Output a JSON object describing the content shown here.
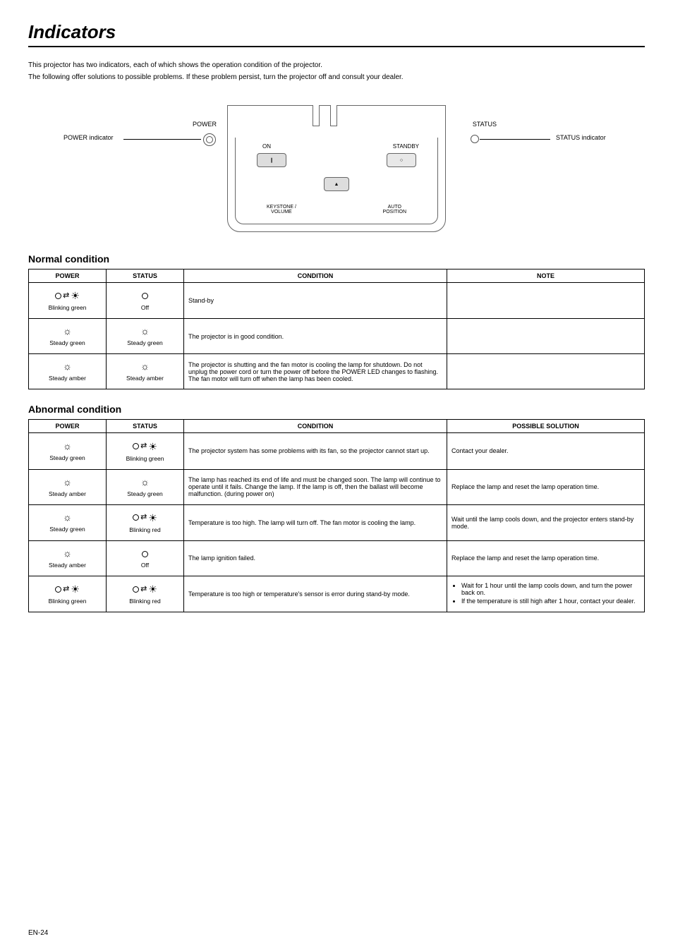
{
  "title": "Indicators",
  "intro": {
    "line1": "This projector has two indicators, each of which shows the operation condition of the projector.",
    "line2": "The following offer solutions to possible problems. If these problem persist, turn the projector off and consult your dealer."
  },
  "diagram": {
    "power_indicator_label": "POWER indicator",
    "status_indicator_label": "STATUS indicator",
    "power_text": "POWER",
    "status_text": "STATUS",
    "btn_on": "ON",
    "btn_standby": "STANDBY",
    "btn_on_glyph": "❙",
    "btn_standby_glyph": "○",
    "btn_tri_glyph": "▲",
    "keystone_label": "KEYSTONE /\nVOLUME",
    "auto_label": "AUTO\nPOSITION"
  },
  "normal": {
    "heading": "Normal condition",
    "headers": {
      "power": "POWER",
      "status": "STATUS",
      "condition": "CONDITION",
      "note": "NOTE"
    },
    "rows": [
      {
        "power": "Blinking green",
        "power_icon": "blink",
        "status": "Off",
        "status_icon": "off",
        "condition": "Stand-by",
        "note": ""
      },
      {
        "power": "Steady green",
        "power_icon": "steady",
        "status": "Steady green",
        "status_icon": "steady",
        "condition": "The projector is in good condition.",
        "note": ""
      },
      {
        "power": "Steady amber",
        "power_icon": "steady",
        "status": "Steady amber",
        "status_icon": "steady",
        "condition": "The projector is shutting and the fan motor is cooling the lamp for shutdown. Do not unplug the power cord or turn the power off before the POWER LED changes to flashing. The fan motor will turn off when the lamp has been cooled.",
        "note": ""
      }
    ]
  },
  "abnormal": {
    "heading": "Abnormal condition",
    "headers": {
      "power": "POWER",
      "status": "STATUS",
      "condition": "CONDITION",
      "solution": "POSSIBLE SOLUTION"
    },
    "rows": [
      {
        "power": "Steady green",
        "power_icon": "steady",
        "status": "Blinking green",
        "status_icon": "blink",
        "condition": "The projector system has some problems with its fan, so the projector cannot start up.",
        "solution": "Contact your dealer."
      },
      {
        "power": "Steady amber",
        "power_icon": "steady",
        "status": "Steady green",
        "status_icon": "steady",
        "condition": "The lamp has reached its end of life and must be changed soon. The lamp will continue to operate until it fails. Change the lamp. If the lamp is off, then the ballast will become malfunction.  (during power on)",
        "solution": "Replace the lamp and reset the lamp operation time."
      },
      {
        "power": "Steady green",
        "power_icon": "steady",
        "status": "Blinking red",
        "status_icon": "blink",
        "condition": "Temperature is too high. The lamp will turn off. The fan motor is cooling the lamp.",
        "solution": "Wait until the lamp cools down, and the projector enters stand-by mode."
      },
      {
        "power": "Steady amber",
        "power_icon": "steady",
        "status": "Off",
        "status_icon": "off",
        "condition": "The lamp ignition failed.",
        "solution": "Replace the lamp and reset the lamp operation time."
      },
      {
        "power": "Blinking green",
        "power_icon": "blink",
        "status": "Blinking red",
        "status_icon": "blink",
        "condition": "Temperature is too high or temperature's sensor is error during stand-by mode.",
        "solution_list": [
          "Wait for 1 hour until the lamp cools down, and turn the power back on.",
          "If the temperature is still high after 1 hour, contact your dealer."
        ]
      }
    ]
  },
  "page_number": "EN-24"
}
